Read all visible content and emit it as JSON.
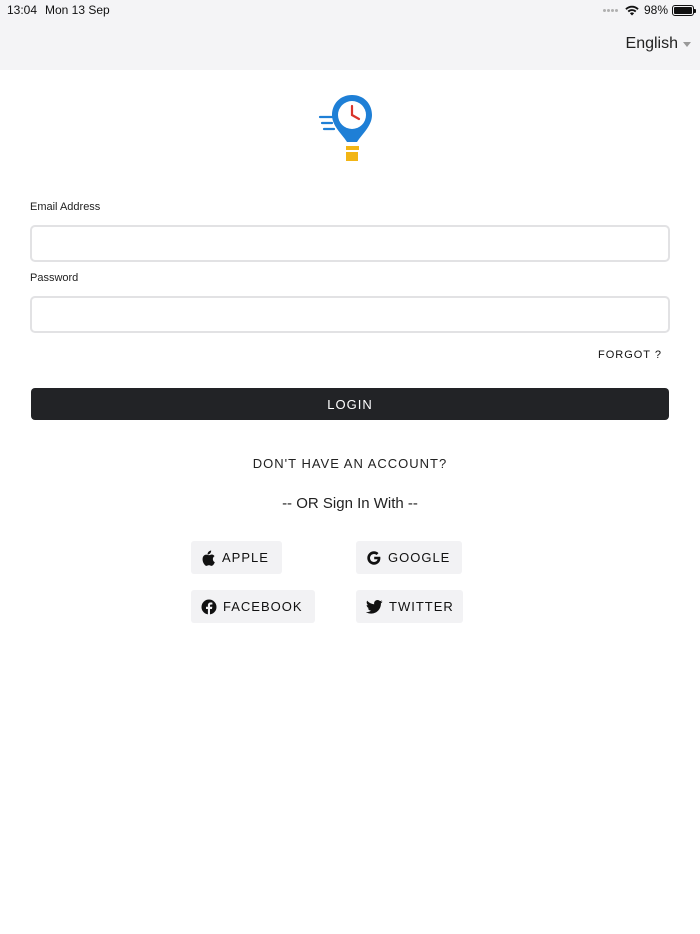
{
  "status_bar": {
    "time": "13:04",
    "date": "Mon 13 Sep",
    "battery": "98%"
  },
  "language": {
    "selected": "English"
  },
  "form": {
    "email_label": "Email Address",
    "email_value": "",
    "password_label": "Password",
    "password_value": "",
    "forgot_label": "FORGOT ?",
    "login_label": "LOGIN"
  },
  "signup_link": "DON'T HAVE AN ACCOUNT?",
  "social": {
    "divider_text": "-- OR Sign In With --",
    "buttons": [
      {
        "label": "APPLE",
        "icon": "apple-icon"
      },
      {
        "label": "GOOGLE",
        "icon": "google-icon"
      },
      {
        "label": "FACEBOOK",
        "icon": "facebook-icon"
      },
      {
        "label": "TWITTER",
        "icon": "twitter-icon"
      }
    ]
  },
  "colors": {
    "logo_blue": "#1e7fd6",
    "logo_yellow": "#f2b515",
    "clock_hand": "#d9342b",
    "login_button": "#222326",
    "top_bar": "#f4f4f6"
  }
}
